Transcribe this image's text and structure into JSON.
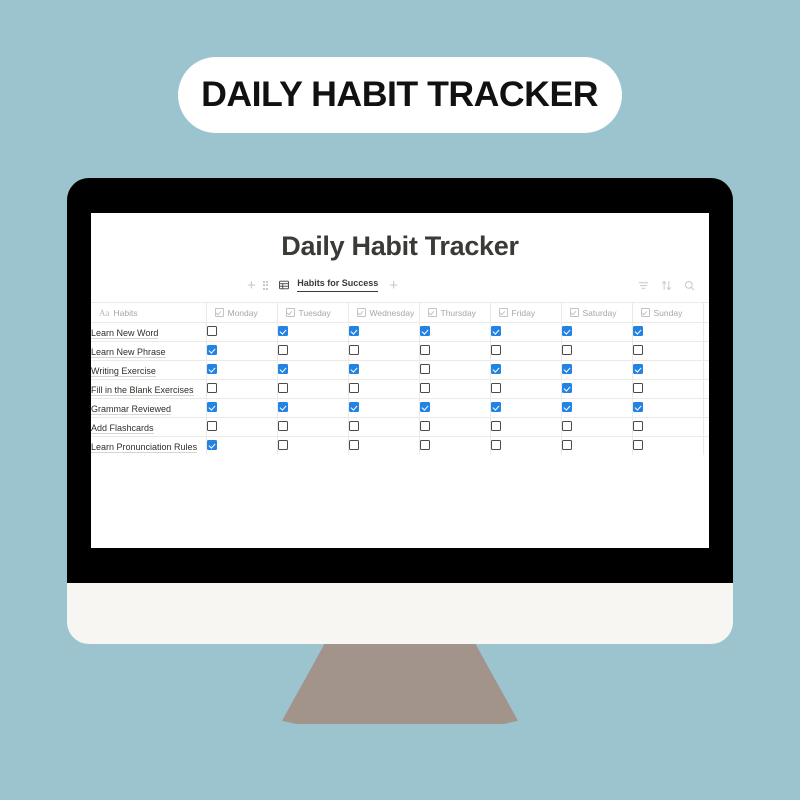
{
  "poster": {
    "background_color": "#9bc4ce",
    "title_pill": {
      "text": "DAILY HABIT TRACKER",
      "background_color": "#ffffff",
      "text_color": "#111111"
    }
  },
  "device": {
    "type": "desktop-monitor",
    "bezel_color": "#000000",
    "chin_color": "#f8f6f3",
    "stand_color": "#a2948b"
  },
  "screen": {
    "page_title": "Daily Habit Tracker",
    "toolbar": {
      "add_icon": "plus-icon",
      "drag_handle_icon": "drag-handle-icon",
      "database_icon": "table-grid-icon",
      "view_name": "Habits for Success",
      "add_view_icon": "plus-icon",
      "filter_icon": "filter-icon",
      "sort_icon": "sort-icon",
      "search_icon": "search-icon"
    },
    "table": {
      "accent_color": "#2383e2",
      "title_prefix_icon": "aa-text-icon",
      "title_column_header": "Habits",
      "title_prefix_label": "Aa",
      "day_columns": [
        {
          "label": "Monday",
          "icon": "checkbox-icon"
        },
        {
          "label": "Tuesday",
          "icon": "checkbox-icon"
        },
        {
          "label": "Wednesday",
          "icon": "checkbox-icon"
        },
        {
          "label": "Thursday",
          "icon": "checkbox-icon"
        },
        {
          "label": "Friday",
          "icon": "checkbox-icon"
        },
        {
          "label": "Saturday",
          "icon": "checkbox-icon"
        },
        {
          "label": "Sunday",
          "icon": "checkbox-icon"
        }
      ],
      "rows": [
        {
          "habit": "Learn New Word",
          "checks": [
            false,
            true,
            true,
            true,
            true,
            true,
            true
          ]
        },
        {
          "habit": "Learn New Phrase",
          "checks": [
            true,
            false,
            false,
            false,
            false,
            false,
            false
          ]
        },
        {
          "habit": "Writing Exercise",
          "checks": [
            true,
            true,
            true,
            false,
            true,
            true,
            true
          ]
        },
        {
          "habit": "Fill in the Blank Exercises",
          "checks": [
            false,
            false,
            false,
            false,
            false,
            true,
            false
          ]
        },
        {
          "habit": "Grammar Reviewed",
          "checks": [
            true,
            true,
            true,
            true,
            true,
            true,
            true
          ]
        },
        {
          "habit": "Add Flashcards",
          "checks": [
            false,
            false,
            false,
            false,
            false,
            false,
            false
          ]
        },
        {
          "habit": "Learn Pronunciation Rules",
          "checks": [
            true,
            false,
            false,
            false,
            false,
            false,
            false
          ]
        }
      ]
    }
  }
}
